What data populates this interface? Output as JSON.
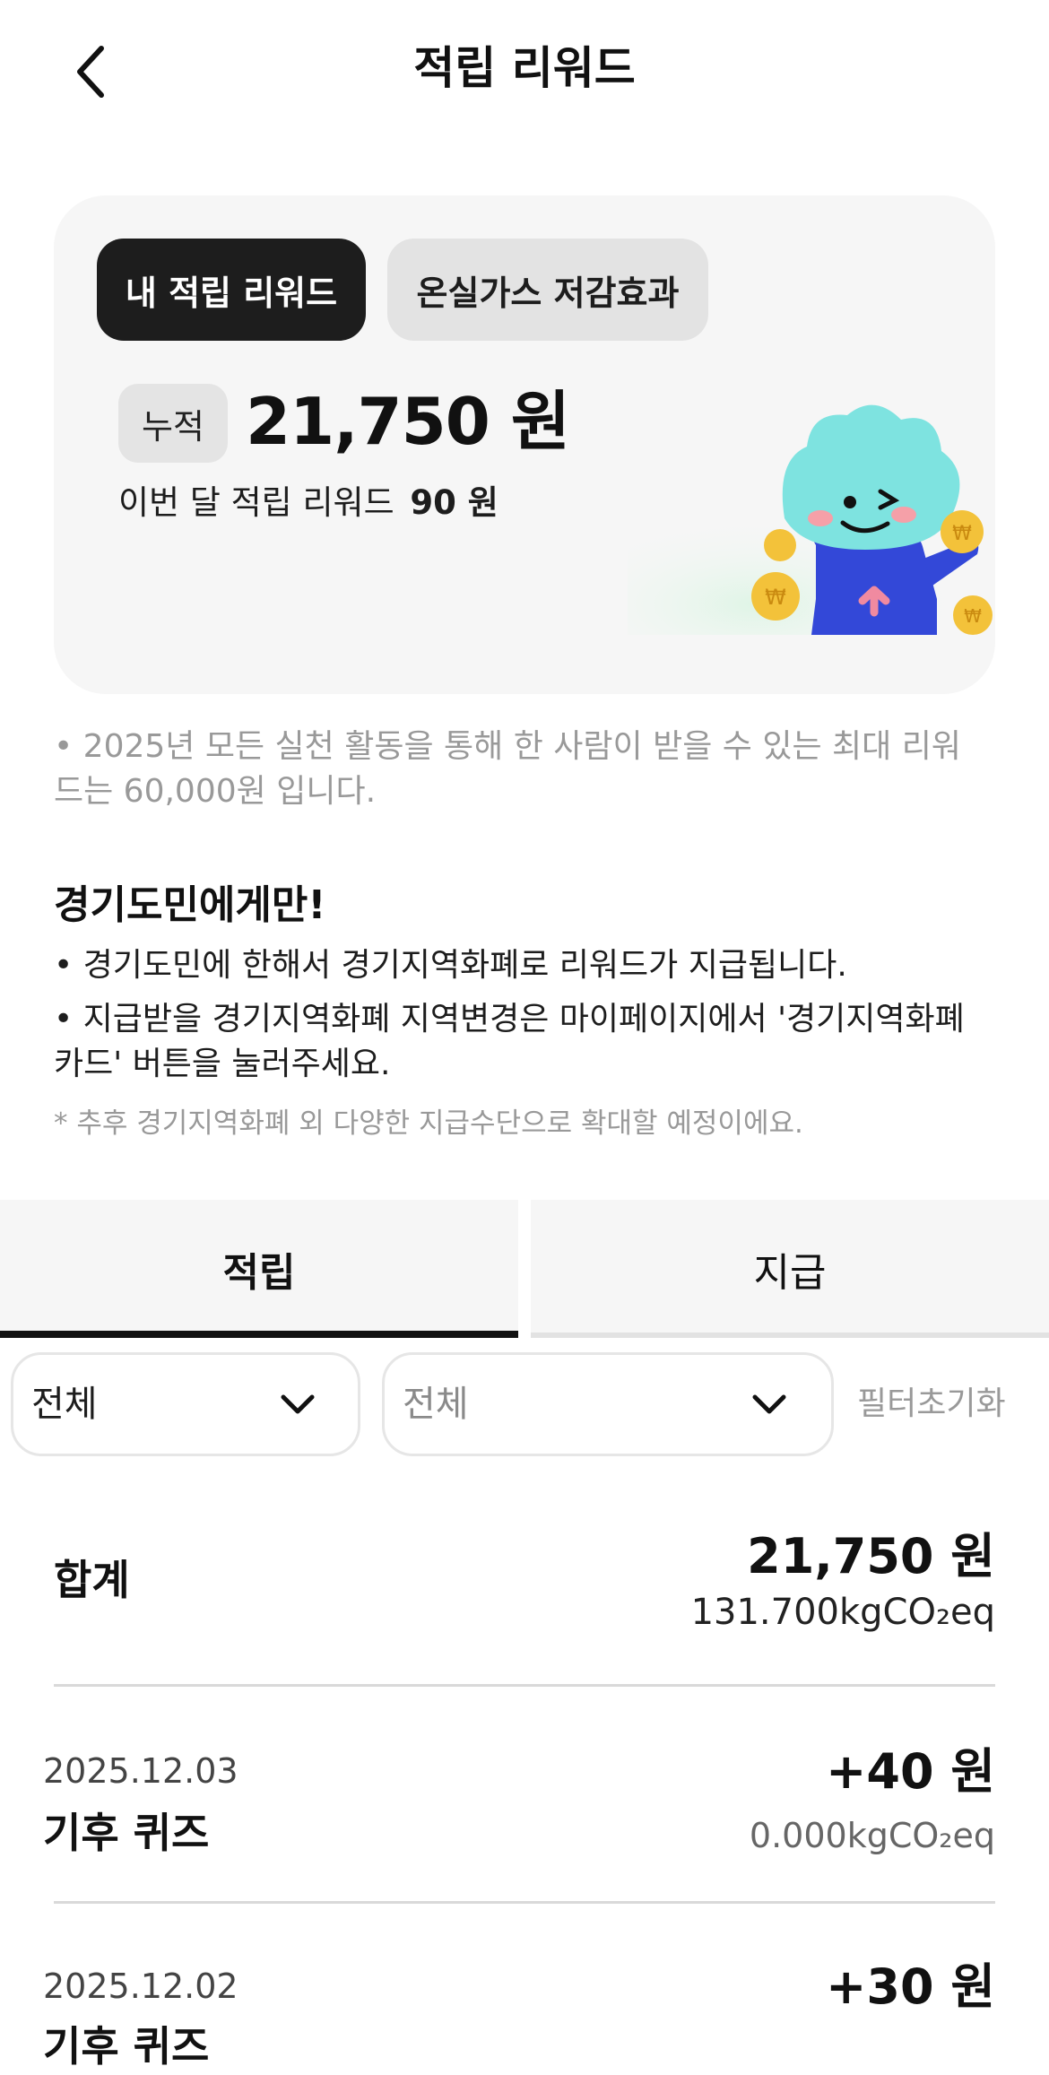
{
  "header": {
    "title": "적립 리워드",
    "back_icon": "chevron-left-icon"
  },
  "card": {
    "tabs": [
      "내 적립 리워드",
      "온실가스 저감효과"
    ],
    "active_tab": 0,
    "cumulative_label": "누적",
    "cumulative_amount": "21,750 원",
    "month_label": "이번 달 적립 리워드",
    "month_amount": "90 원",
    "mascot_icon": "mascot-character-icon"
  },
  "notice": "• 2025년 모든 실천 활동을 통해 한 사람이 받을 수 있는 최대 리워드는 60,000원 입니다.",
  "promo": {
    "title": "경기도민에게만!",
    "items": [
      "• 경기도민에 한해서 경기지역화폐로 리워드가 지급됩니다.",
      "• 지급받을 경기지역화폐 지역변경은 마이페이지에서 '경기지역화폐 카드' 버튼을 눌러주세요."
    ],
    "note": "* 추후 경기지역화폐 외 다양한 지급수단으로 확대할 예정이에요."
  },
  "history_tabs": {
    "save": "적립",
    "pay": "지급",
    "active": "save"
  },
  "filters": {
    "first": "전체",
    "second": "전체",
    "reset": "필터초기화"
  },
  "total": {
    "label": "합계",
    "amount": "21,750 원",
    "co2": "131.700kgCO₂eq"
  },
  "entries": [
    {
      "date": "2025.12.03",
      "title": "기후 퀴즈",
      "amount": "+40 원",
      "co2": "0.000kgCO₂eq"
    },
    {
      "date": "2025.12.02",
      "title": "기후 퀴즈",
      "amount": "+30 원",
      "co2": ""
    }
  ],
  "colors": {
    "dark": "#1d1d1d",
    "card_bg": "#f6f6f6",
    "muted": "#999999",
    "mascot": "#7ee3e0",
    "coin": "#f3c23a"
  }
}
